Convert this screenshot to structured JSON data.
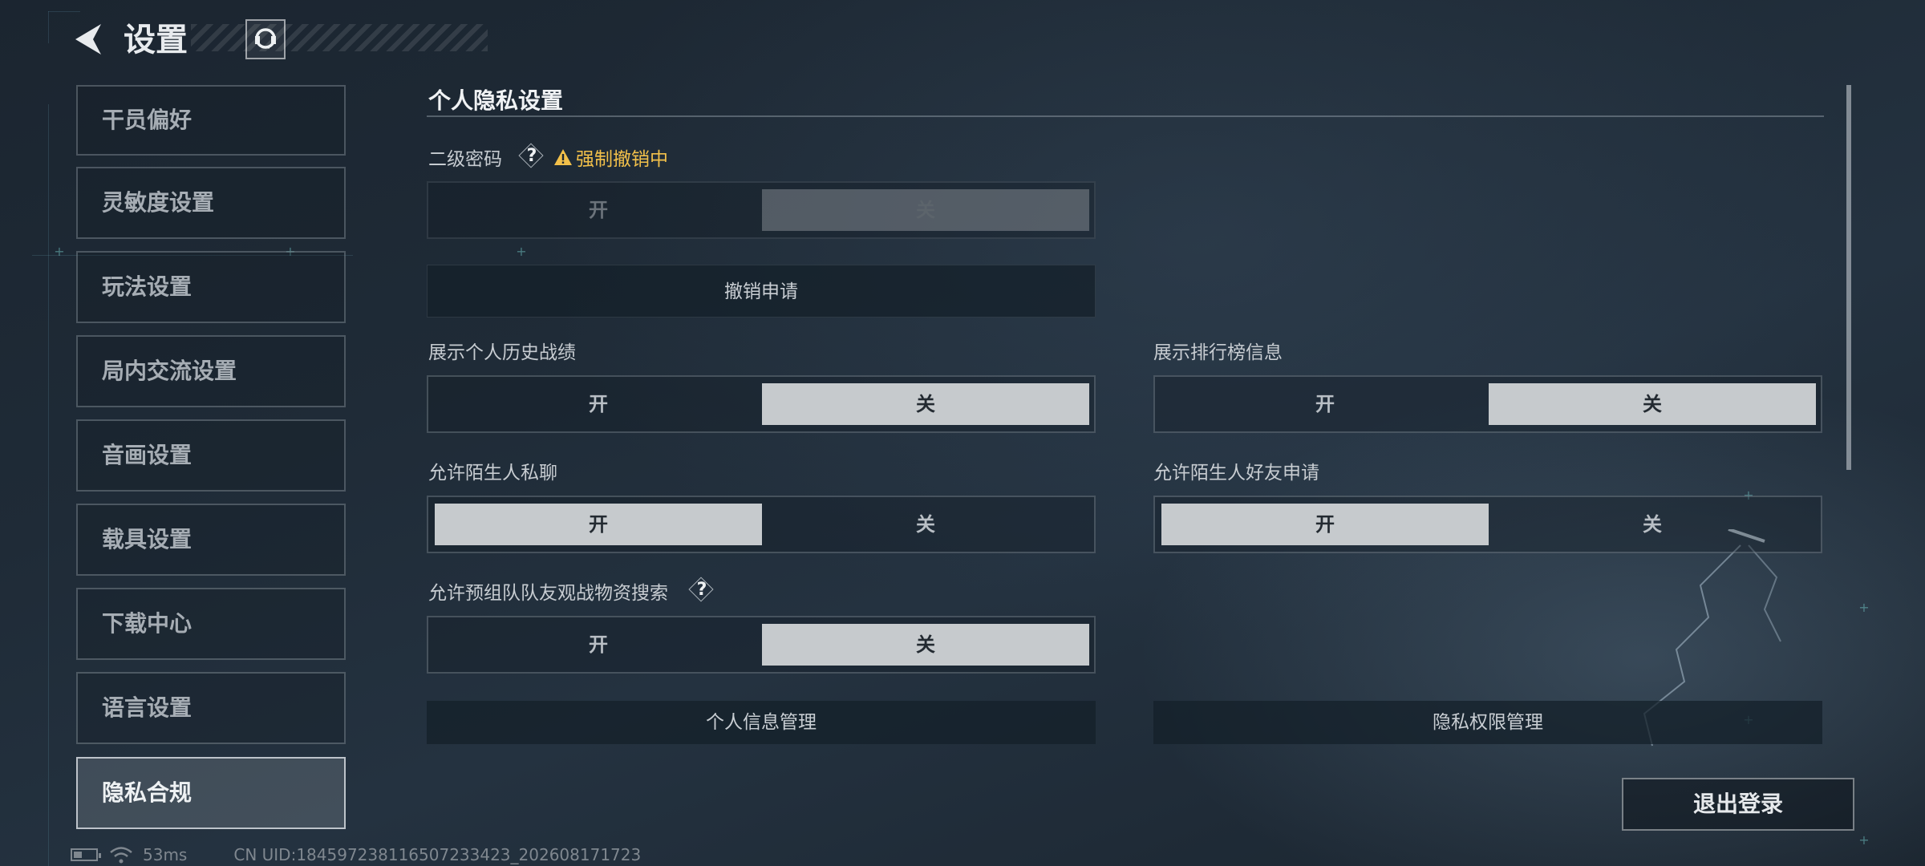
{
  "header": {
    "title": "设置"
  },
  "sidebar": {
    "items": [
      {
        "label": "干员偏好"
      },
      {
        "label": "灵敏度设置"
      },
      {
        "label": "玩法设置"
      },
      {
        "label": "局内交流设置"
      },
      {
        "label": "音画设置"
      },
      {
        "label": "载具设置"
      },
      {
        "label": "下载中心"
      },
      {
        "label": "语言设置"
      },
      {
        "label": "隐私合规",
        "active": true
      }
    ]
  },
  "privacy": {
    "section_title": "个人隐私设置",
    "secondary_password": {
      "label": "二级密码",
      "help": "?",
      "warning": "强制撤销中",
      "on": "开",
      "off": "关",
      "selected": "off",
      "disabled": true
    },
    "revoke_button": "撤销申请",
    "show_history": {
      "label": "展示个人历史战绩",
      "on": "开",
      "off": "关",
      "selected": "off"
    },
    "show_leaderboard": {
      "label": "展示排行榜信息",
      "on": "开",
      "off": "关",
      "selected": "off"
    },
    "stranger_chat": {
      "label": "允许陌生人私聊",
      "on": "开",
      "off": "关",
      "selected": "on"
    },
    "stranger_friend": {
      "label": "允许陌生人好友申请",
      "on": "开",
      "off": "关",
      "selected": "on"
    },
    "team_search": {
      "label": "允许预组队队友观战物资搜索",
      "help": "?",
      "on": "开",
      "off": "关",
      "selected": "off"
    },
    "personal_info_button": "个人信息管理",
    "privacy_permission_button": "隐私权限管理"
  },
  "logout_button": "退出登录",
  "status_bar": {
    "ping": "53ms",
    "uid": "CN UID:1845972381165072334​23_202608171723"
  },
  "colors": {
    "warning": "#f2c04a",
    "selected_option": "#c6cacd"
  },
  "icons": [
    "back-arrow-icon",
    "customer-support-icon",
    "help-icon",
    "warning-icon",
    "battery-icon",
    "wifi-icon"
  ]
}
